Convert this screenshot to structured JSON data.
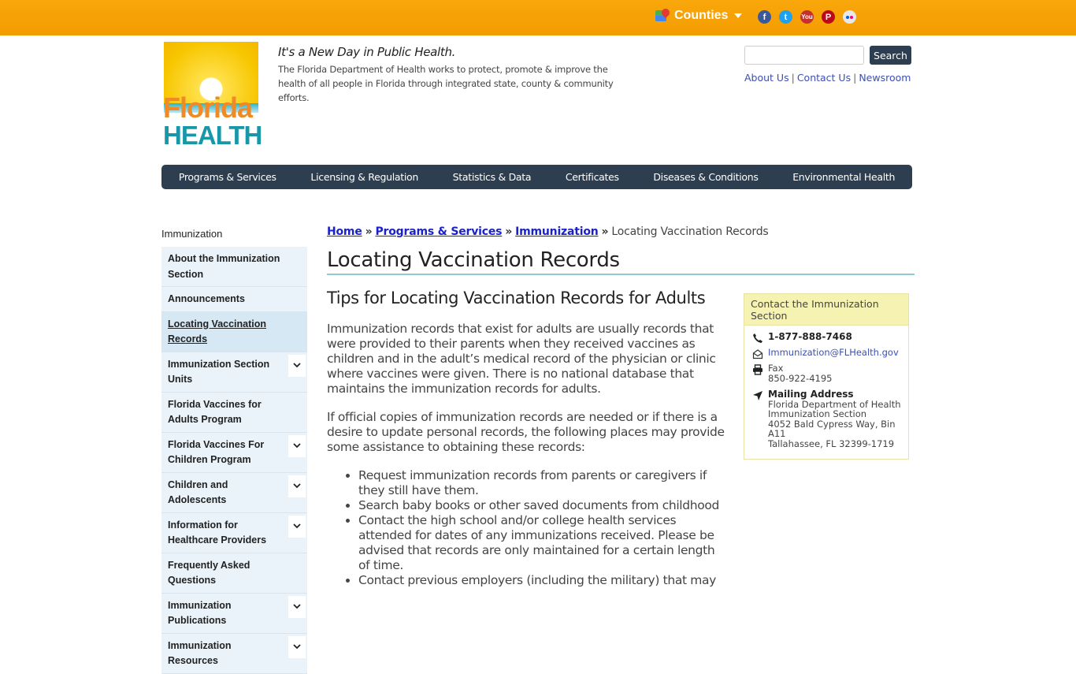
{
  "topbar": {
    "counties_label": "Counties",
    "social": [
      {
        "name": "facebook",
        "glyph": "f"
      },
      {
        "name": "twitter",
        "glyph": "t"
      },
      {
        "name": "youtube",
        "glyph": "You"
      },
      {
        "name": "pinterest",
        "glyph": "P"
      },
      {
        "name": "flickr",
        "glyph": ""
      }
    ]
  },
  "header": {
    "logo_top": "Florida",
    "logo_bottom": "HEALTH",
    "tagline": "It's a New Day in Public Health.",
    "mission": "The Florida Department of Health works to protect, promote & improve the health of all people in Florida through integrated state, county & community efforts.",
    "search": {
      "placeholder": "",
      "value": "",
      "button_label": "Search"
    },
    "utility_links": [
      "About Us",
      "Contact Us",
      "Newsroom"
    ]
  },
  "mainnav": [
    "Programs & Services",
    "Licensing & Regulation",
    "Statistics & Data",
    "Certificates",
    "Diseases & Conditions",
    "Environmental Health"
  ],
  "sidebar": {
    "title": "Immunization",
    "items": [
      {
        "label": "About the Immunization Section",
        "expandable": false,
        "active": false
      },
      {
        "label": "Announcements",
        "expandable": false,
        "active": false
      },
      {
        "label": "Locating Vaccination Records",
        "expandable": false,
        "active": true
      },
      {
        "label": "Immunization Section Units",
        "expandable": true,
        "active": false
      },
      {
        "label": "Florida Vaccines for Adults Program",
        "expandable": false,
        "active": false
      },
      {
        "label": "Florida Vaccines For Children Program",
        "expandable": true,
        "active": false
      },
      {
        "label": "Children and Adolescents",
        "expandable": true,
        "active": false
      },
      {
        "label": "Information for Healthcare Providers",
        "expandable": true,
        "active": false
      },
      {
        "label": "Frequently Asked Questions",
        "expandable": false,
        "active": false
      },
      {
        "label": "Immunization Publications",
        "expandable": true,
        "active": false
      },
      {
        "label": "Immunization Resources",
        "expandable": true,
        "active": false
      }
    ]
  },
  "breadcrumb": {
    "links": [
      "Home",
      "Programs & Services",
      "Immunization"
    ],
    "separator": "»",
    "current": "Locating Vaccination Records"
  },
  "content": {
    "title": "Locating Vaccination Records",
    "subtitle": "Tips for Locating Vaccination Records for Adults",
    "paragraph1": "Immunization records that exist for adults are usually records that were provided to their parents when they received vaccines as children and in the adult’s medical record of the physician or clinic where vaccines were given. There is no national database that maintains the immunization records for adults.",
    "paragraph2": "If official copies of immunization records are needed or if there is a desire to update personal records, the following places may provide some assistance to obtaining these records:",
    "bullets": [
      "Request immunization records from parents or caregivers if they still have them.",
      "Search baby books or other saved documents from childhood",
      "Contact the high school and/or college health services attended for dates of any immunizations received. Please be advised that records are only maintained for a certain length of time.",
      "Contact previous employers (including the military) that may"
    ]
  },
  "contact": {
    "header": "Contact the Immunization Section",
    "phone": "1-877-888-7468",
    "email": "Immunization@FLHealth.gov",
    "fax_label": "Fax",
    "fax_number": "850-922-4195",
    "mail_label": "Mailing Address",
    "address_lines": [
      "Florida Department of Health",
      "Immunization Section",
      "4052 Bald Cypress Way, Bin A11",
      "Tallahassee, FL 32399-1719"
    ]
  },
  "colors": {
    "topbar": "#f5a000",
    "nav": "#2c3e50",
    "link": "#1a21c9",
    "utility_link": "#3b4fb5",
    "sidebar_bg": "#eaf3fa",
    "contact_header_bg": "#f6f2b2",
    "title_rule": "#8ecbd6"
  }
}
